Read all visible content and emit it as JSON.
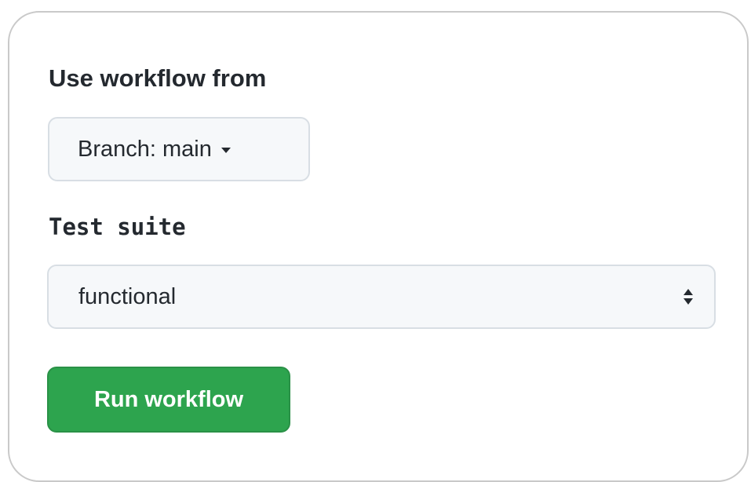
{
  "form": {
    "workflow_source_label": "Use workflow from",
    "branch_button": {
      "prefix": "Branch: ",
      "value": "main",
      "icon": "caret-down-icon"
    },
    "test_suite": {
      "label": "Test suite",
      "selected": "functional",
      "icon": "select-arrows-icon"
    },
    "run_button_label": "Run workflow"
  },
  "colors": {
    "primary_button": "#2da44e",
    "text": "#24292f",
    "control_background": "#f6f8fa",
    "control_border": "#d8dee4"
  }
}
